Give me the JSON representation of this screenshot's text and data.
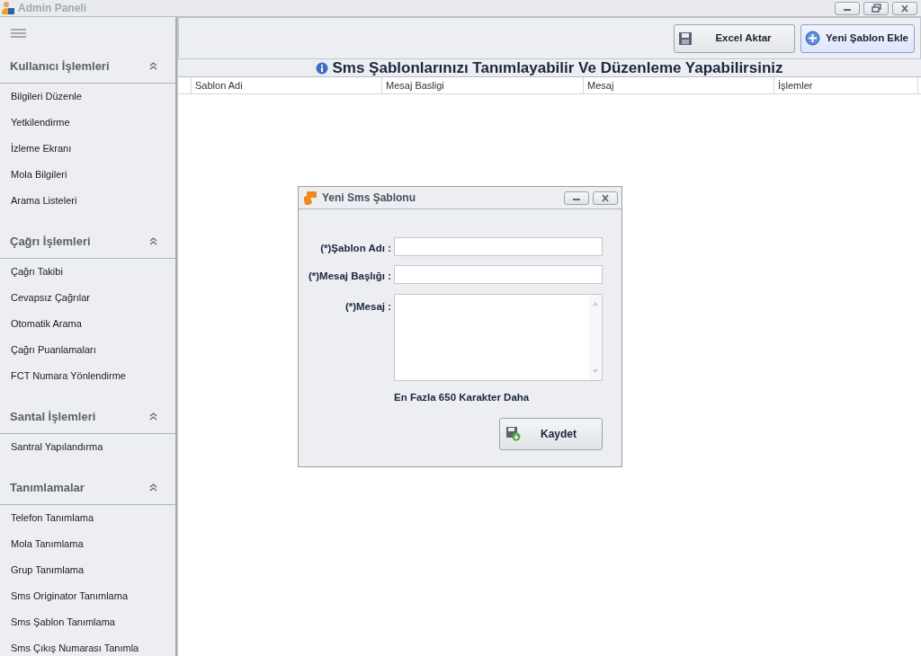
{
  "window": {
    "title": "Admin Paneli"
  },
  "sidebar": {
    "groups": [
      {
        "title": "Kullanıcı İşlemleri",
        "expanded": true,
        "items": [
          "Bilgileri Düzenle",
          "Yetkilendirme",
          "İzleme Ekranı",
          "Mola Bilgileri",
          "Arama Listeleri"
        ]
      },
      {
        "title": "Çağrı İşlemleri",
        "expanded": true,
        "items": [
          "Çağrı Takibi",
          "Cevapsız Çağrılar",
          "Otomatik Arama",
          "Çağrı Puanlamaları",
          "FCT Numara Yönlendirme"
        ]
      },
      {
        "title": "Santal İşlemleri",
        "expanded": true,
        "items": [
          "Santral Yapılandırma"
        ]
      },
      {
        "title": "Tanımlamalar",
        "expanded": true,
        "items": [
          "Telefon Tanımlama",
          "Mola Tanımlama",
          "Grup Tanımlama",
          "Sms Originator Tanımlama",
          "Sms Şablon Tanımlama",
          "Sms Çıkış Numarası Tanımla"
        ]
      }
    ]
  },
  "toolbar": {
    "buttons": [
      {
        "kind": "excel",
        "label": "Excel Aktar",
        "selected": false
      },
      {
        "kind": "add",
        "label": "Yeni Şablon Ekle",
        "selected": true
      }
    ]
  },
  "heading": "Sms Şablonlarınızı Tanımlayabilir Ve Düzenleme Yapabilirsiniz",
  "table": {
    "columns": [
      "Sablon Adi",
      "Mesaj Basligi",
      "Mesaj",
      "İşlemler"
    ]
  },
  "dialog": {
    "title": "Yeni Sms Şablonu",
    "fields": [
      {
        "kind": "text",
        "label": "(*)Şablon Adı :"
      },
      {
        "kind": "text",
        "label": "(*)Mesaj Başlığı :"
      },
      {
        "kind": "memo",
        "label": "(*)Mesaj :"
      }
    ],
    "note": "En Fazla 650 Karakter Daha",
    "save_button": "Kaydet"
  }
}
